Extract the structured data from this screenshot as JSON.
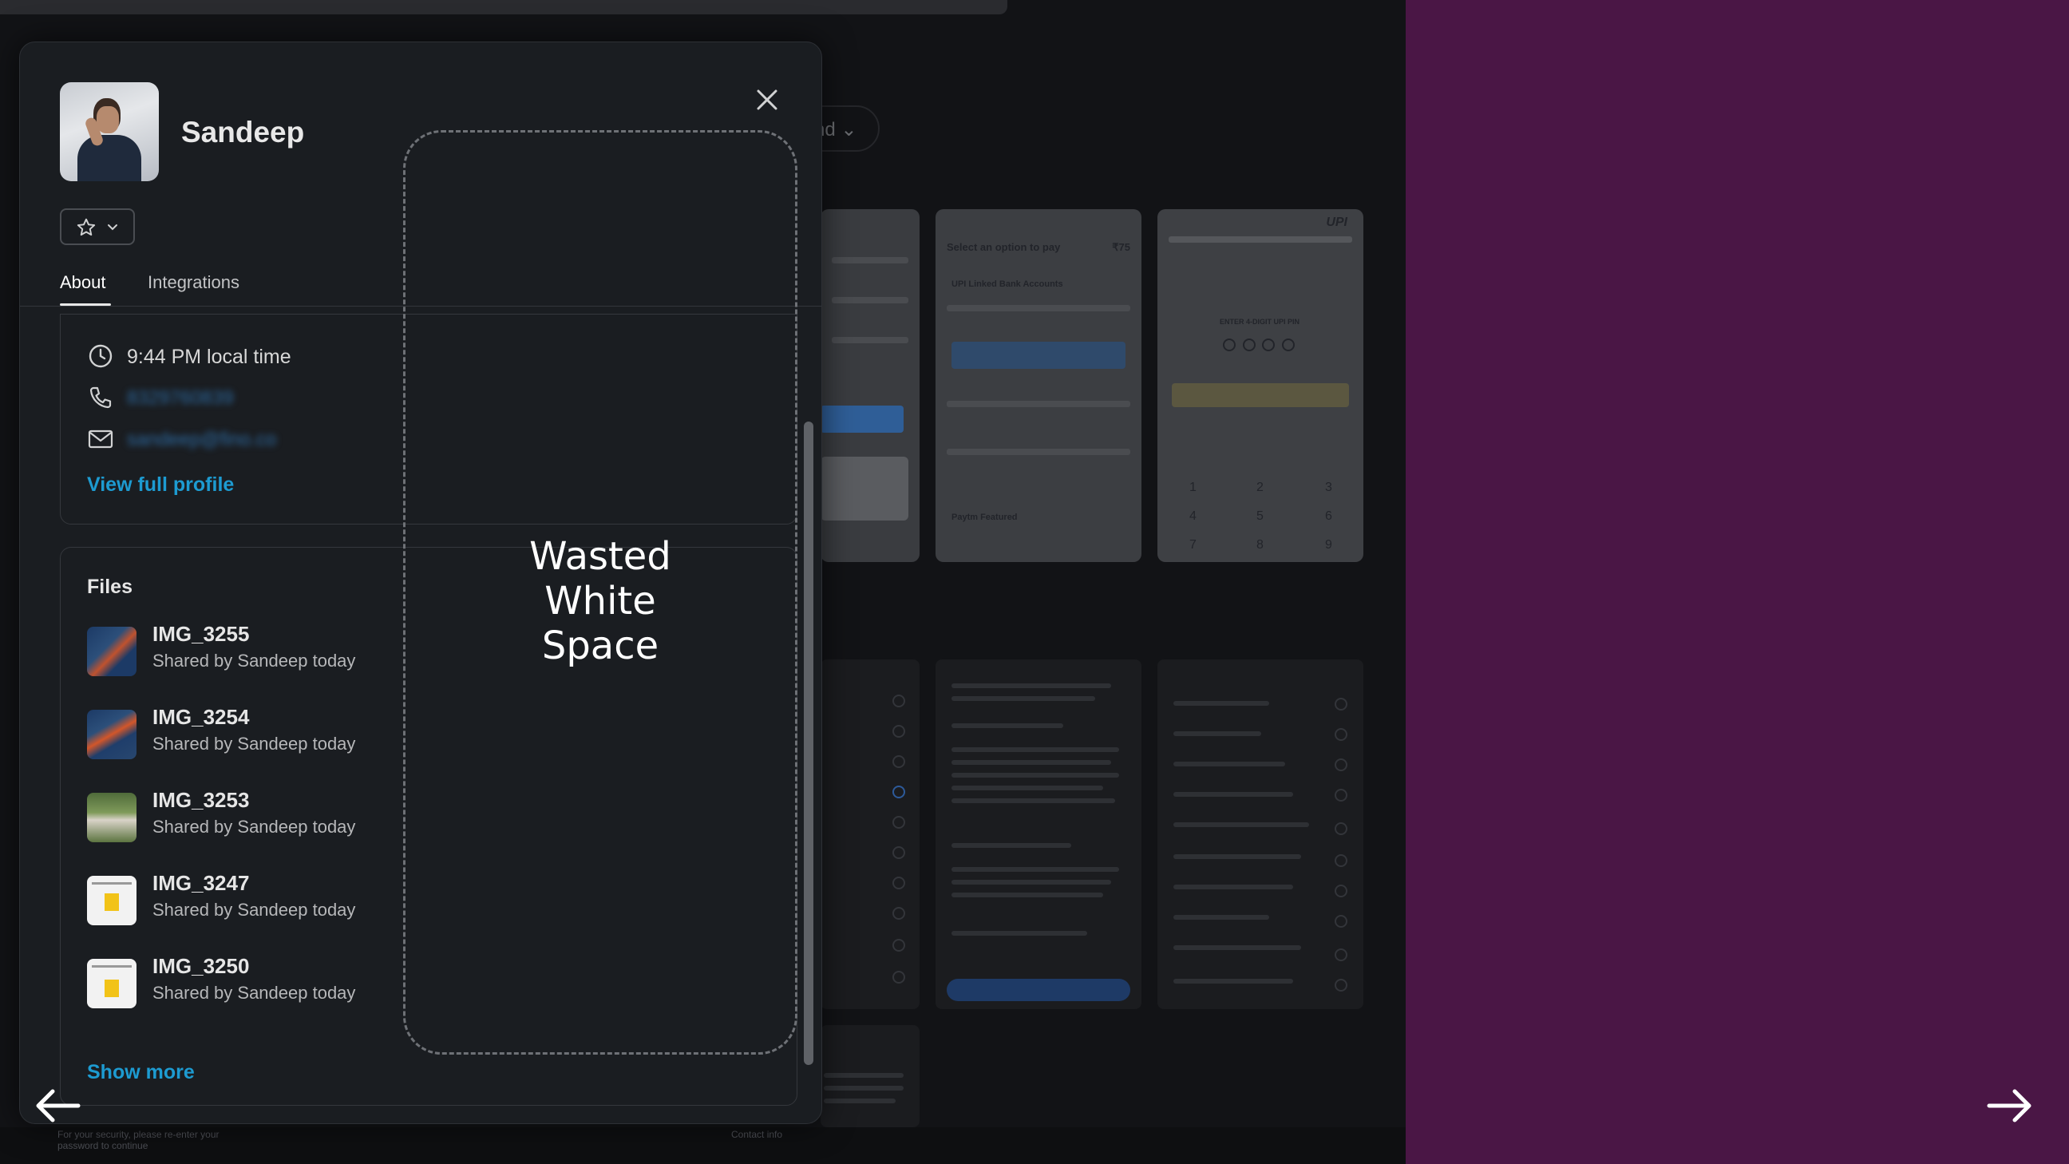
{
  "profile": {
    "name": "Sandeep",
    "tabs": [
      {
        "label": "About",
        "active": true
      },
      {
        "label": "Integrations",
        "active": false
      }
    ],
    "local_time": "9:44 PM local time",
    "phone": "8329760839",
    "email": "sandeep@fino.co",
    "view_profile": "View full profile"
  },
  "files": {
    "title": "Files",
    "items": [
      {
        "name": "IMG_3255",
        "sub": "Shared by Sandeep today"
      },
      {
        "name": "IMG_3254",
        "sub": "Shared by Sandeep today"
      },
      {
        "name": "IMG_3253",
        "sub": "Shared by Sandeep today"
      },
      {
        "name": "IMG_3247",
        "sub": "Shared by Sandeep today"
      },
      {
        "name": "IMG_3250",
        "sub": "Shared by Sandeep today"
      }
    ],
    "show_more": "Show more"
  },
  "annotation": {
    "lines": [
      "Wasted",
      "White",
      "Space"
    ]
  },
  "background": {
    "pill_label": "nd",
    "phone2_header": "Select an option to pay",
    "phone2_amount": "₹75",
    "phone2_section": "UPI Linked Bank Accounts",
    "phone2_featured": "Paytm Featured",
    "phone3_brand": "UPI",
    "phone3_pin": "ENTER 4-DIGIT UPI PIN",
    "keypad": [
      "1",
      "2",
      "3",
      "4",
      "5",
      "6",
      "7",
      "8",
      "9"
    ],
    "bottom_left": "For your security, please re-enter your password to continue",
    "bottom_contact": "Contact info"
  },
  "colors": {
    "modal_bg": "#1a1d21",
    "link": "#1d9bd1",
    "right_panel": "#4a1645"
  },
  "icons": {
    "close": "close-icon",
    "star": "star-icon",
    "clock": "clock-icon",
    "phone": "phone-icon",
    "mail": "mail-icon",
    "prev": "arrow-left-icon",
    "next": "arrow-right-icon"
  }
}
